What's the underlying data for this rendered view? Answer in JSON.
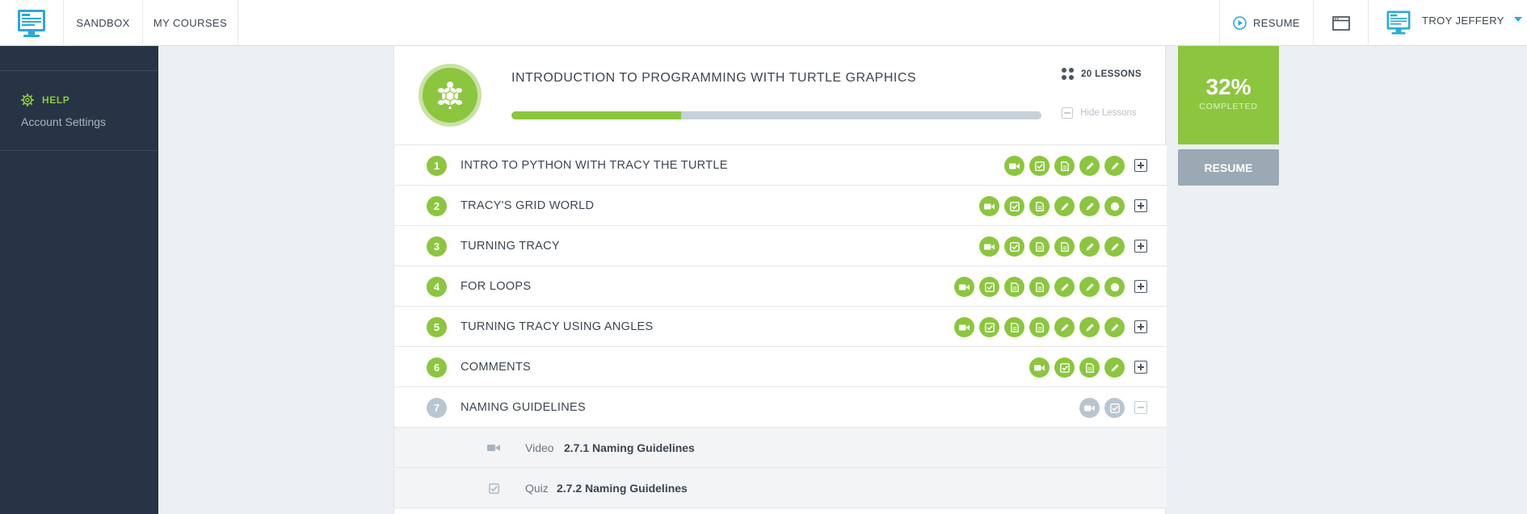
{
  "nav": {
    "sandbox": "SANDBOX",
    "my_courses": "MY COURSES",
    "resume": "RESUME",
    "user_name": "TROY JEFFERY"
  },
  "sidebar": {
    "help": "HELP",
    "account_settings": "Account Settings"
  },
  "course": {
    "title": "INTRODUCTION TO PROGRAMMING WITH TURTLE GRAPHICS",
    "lessons_count": "20 LESSONS",
    "hide_lessons": "Hide Lessons",
    "progress_fraction": 0.32,
    "percent_completed": "32%",
    "completed_label": "COMPLETED",
    "resume_label": "RESUME"
  },
  "lessons": [
    {
      "num": "1",
      "title": "INTRO TO PYTHON WITH TRACY THE TURTLE",
      "icons": [
        "video",
        "quiz",
        "document",
        "pencil",
        "pencil"
      ],
      "toggle": "plus",
      "status": "active"
    },
    {
      "num": "2",
      "title": "TRACY'S GRID WORLD",
      "icons": [
        "video",
        "quiz",
        "document",
        "pencil",
        "pencil",
        "circle"
      ],
      "toggle": "plus",
      "status": "active"
    },
    {
      "num": "3",
      "title": "TURNING TRACY",
      "icons": [
        "video",
        "quiz",
        "document",
        "document",
        "pencil",
        "pencil"
      ],
      "toggle": "plus",
      "status": "active"
    },
    {
      "num": "4",
      "title": "FOR LOOPS",
      "icons": [
        "video",
        "quiz",
        "document",
        "document",
        "pencil",
        "pencil",
        "circle"
      ],
      "toggle": "plus",
      "status": "active"
    },
    {
      "num": "5",
      "title": "TURNING TRACY USING ANGLES",
      "icons": [
        "video",
        "quiz",
        "document",
        "document",
        "pencil",
        "pencil",
        "pencil"
      ],
      "toggle": "plus",
      "status": "active"
    },
    {
      "num": "6",
      "title": "COMMENTS",
      "icons": [
        "video",
        "quiz",
        "document",
        "pencil"
      ],
      "toggle": "plus",
      "status": "active"
    },
    {
      "num": "7",
      "title": "NAMING GUIDELINES",
      "icons": [
        "video",
        "quiz"
      ],
      "toggle": "minus",
      "status": "inactive"
    }
  ],
  "sub_items": [
    {
      "icon": "video",
      "type": "Video",
      "name": "2.7.1 Naming Guidelines"
    },
    {
      "icon": "quiz",
      "type": "Quiz",
      "name": "2.7.2 Naming Guidelines"
    }
  ],
  "colors": {
    "accent_green": "#8cc63f",
    "sidebar_bg": "#263445",
    "link_blue": "#29a7de",
    "inactive_gray": "#b9c6cf"
  }
}
